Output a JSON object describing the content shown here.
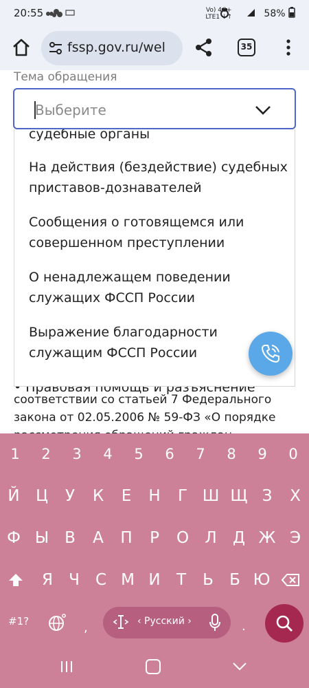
{
  "status_bar": {
    "time": "20:55",
    "network_top": "Vo) 4G+",
    "network_bottom": "LTE1 ↓↑",
    "battery": "58%"
  },
  "browser": {
    "url": "fssp.gov.ru/wel",
    "tab_count": "35"
  },
  "form": {
    "field_label": "Тема обращения",
    "select_placeholder": "Выберите"
  },
  "dropdown": {
    "items": [
      {
        "line1": "судебные органы",
        "line2": ""
      },
      {
        "line1": "На действия (бездействие) судебных",
        "line2": "приставов-дознавателей"
      },
      {
        "line1": "Сообщения о готовящемся или",
        "line2": "совершенном преступлении"
      },
      {
        "line1": "О ненадлежащем поведении",
        "line2": "служащих ФССП России"
      },
      {
        "line1": "Выражение благодарности",
        "line2": "служащим ФССП России"
      }
    ]
  },
  "behind": {
    "partial_top": "• Правовая помощь и разъяснение",
    "line1": "соответствии со статьей 7 Федерального",
    "line2": "закона от 02.05.2006 № 59-ФЗ «О порядке",
    "line3": "рассмотрения обращений граждан"
  },
  "keyboard": {
    "row_numbers": [
      "1",
      "2",
      "3",
      "4",
      "5",
      "6",
      "7",
      "8",
      "9",
      "0"
    ],
    "row1": [
      "Й",
      "Ц",
      "У",
      "К",
      "Е",
      "Н",
      "Г",
      "Ш",
      "Щ",
      "З",
      "Х"
    ],
    "row2": [
      "Ф",
      "Ы",
      "В",
      "А",
      "П",
      "Р",
      "О",
      "Л",
      "Д",
      "Ж",
      "Э"
    ],
    "row3": [
      "Я",
      "Ч",
      "С",
      "М",
      "И",
      "Т",
      "Ь",
      "Б",
      "Ю"
    ],
    "sym_label": "#1?",
    "comma": ",",
    "space_label": "‹ Русский ›",
    "dot": ".",
    "colors": {
      "background": "#cc8199",
      "space": "#b75f7e",
      "search": "#a4284f"
    }
  }
}
